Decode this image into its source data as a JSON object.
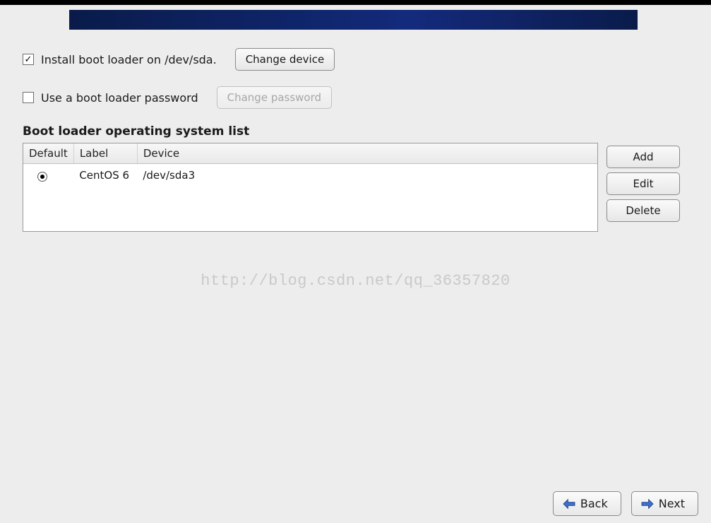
{
  "install_loader": {
    "checked": true,
    "label": "Install boot loader on /dev/sda.",
    "change_button": "Change device"
  },
  "use_password": {
    "checked": false,
    "label": "Use a boot loader password",
    "change_button": "Change password"
  },
  "list_title": "Boot loader operating system list",
  "columns": {
    "default": "Default",
    "label": "Label",
    "device": "Device"
  },
  "entries": [
    {
      "default": true,
      "label": "CentOS 6",
      "device": "/dev/sda3"
    }
  ],
  "side_buttons": {
    "add": "Add",
    "edit": "Edit",
    "delete": "Delete"
  },
  "watermark": "http://blog.csdn.net/qq_36357820",
  "nav": {
    "back": "Back",
    "next": "Next"
  }
}
